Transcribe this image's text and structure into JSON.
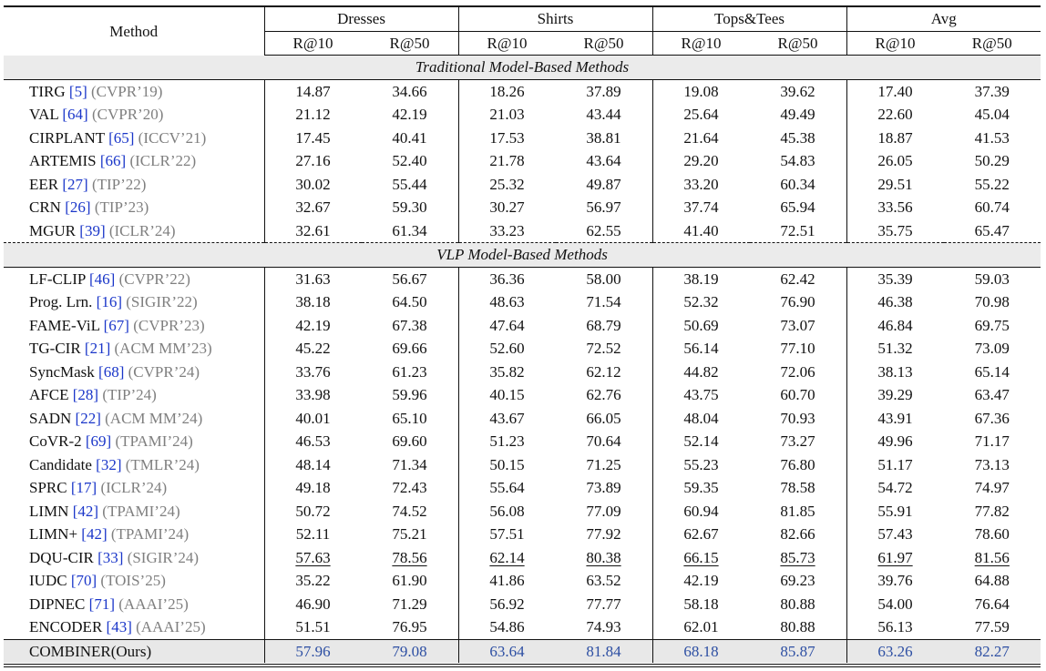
{
  "header": {
    "method": "Method",
    "groups": [
      "Dresses",
      "Shirts",
      "Tops&Tees",
      "Avg"
    ],
    "metrics": [
      "R@10",
      "R@50"
    ]
  },
  "sections": [
    {
      "title": "Traditional Model-Based Methods",
      "rows": [
        {
          "name": "TIRG",
          "cite": "5",
          "venue": "(CVPR’19)",
          "values": [
            "14.87",
            "34.66",
            "18.26",
            "37.89",
            "19.08",
            "39.62",
            "17.40",
            "37.39"
          ]
        },
        {
          "name": "VAL",
          "cite": "64",
          "venue": "(CVPR’20)",
          "values": [
            "21.12",
            "42.19",
            "21.03",
            "43.44",
            "25.64",
            "49.49",
            "22.60",
            "45.04"
          ]
        },
        {
          "name": "CIRPLANT",
          "cite": "65",
          "venue": "(ICCV’21)",
          "values": [
            "17.45",
            "40.41",
            "17.53",
            "38.81",
            "21.64",
            "45.38",
            "18.87",
            "41.53"
          ]
        },
        {
          "name": "ARTEMIS",
          "cite": "66",
          "venue": "(ICLR’22)",
          "values": [
            "27.16",
            "52.40",
            "21.78",
            "43.64",
            "29.20",
            "54.83",
            "26.05",
            "50.29"
          ]
        },
        {
          "name": "EER",
          "cite": "27",
          "venue": "(TIP’22)",
          "values": [
            "30.02",
            "55.44",
            "25.32",
            "49.87",
            "33.20",
            "60.34",
            "29.51",
            "55.22"
          ]
        },
        {
          "name": "CRN",
          "cite": "26",
          "venue": "(TIP’23)",
          "values": [
            "32.67",
            "59.30",
            "30.27",
            "56.97",
            "37.74",
            "65.94",
            "33.56",
            "60.74"
          ]
        },
        {
          "name": "MGUR",
          "cite": "39",
          "venue": "(ICLR’24)",
          "values": [
            "32.61",
            "61.34",
            "33.23",
            "62.55",
            "41.40",
            "72.51",
            "35.75",
            "65.47"
          ]
        }
      ]
    },
    {
      "title": "VLP Model-Based Methods",
      "rows": [
        {
          "name": "LF-CLIP",
          "cite": "46",
          "venue": "(CVPR’22)",
          "values": [
            "31.63",
            "56.67",
            "36.36",
            "58.00",
            "38.19",
            "62.42",
            "35.39",
            "59.03"
          ]
        },
        {
          "name": "Prog. Lrn.",
          "cite": "16",
          "venue": "(SIGIR’22)",
          "values": [
            "38.18",
            "64.50",
            "48.63",
            "71.54",
            "52.32",
            "76.90",
            "46.38",
            "70.98"
          ]
        },
        {
          "name": "FAME-ViL",
          "cite": "67",
          "venue": "(CVPR’23)",
          "values": [
            "42.19",
            "67.38",
            "47.64",
            "68.79",
            "50.69",
            "73.07",
            "46.84",
            "69.75"
          ]
        },
        {
          "name": "TG-CIR",
          "cite": "21",
          "venue": "(ACM MM’23)",
          "values": [
            "45.22",
            "69.66",
            "52.60",
            "72.52",
            "56.14",
            "77.10",
            "51.32",
            "73.09"
          ]
        },
        {
          "name": "SyncMask",
          "cite": "68",
          "venue": "(CVPR’24)",
          "values": [
            "33.76",
            "61.23",
            "35.82",
            "62.12",
            "44.82",
            "72.06",
            "38.13",
            "65.14"
          ]
        },
        {
          "name": "AFCE",
          "cite": "28",
          "venue": "(TIP’24)",
          "values": [
            "33.98",
            "59.96",
            "40.15",
            "62.76",
            "43.75",
            "60.70",
            "39.29",
            "63.47"
          ]
        },
        {
          "name": "SADN",
          "cite": "22",
          "venue": "(ACM MM’24)",
          "values": [
            "40.01",
            "65.10",
            "43.67",
            "66.05",
            "48.04",
            "70.93",
            "43.91",
            "67.36"
          ]
        },
        {
          "name": "CoVR-2",
          "cite": "69",
          "venue": "(TPAMI’24)",
          "values": [
            "46.53",
            "69.60",
            "51.23",
            "70.64",
            "52.14",
            "73.27",
            "49.96",
            "71.17"
          ]
        },
        {
          "name": "Candidate",
          "cite": "32",
          "venue": "(TMLR’24)",
          "values": [
            "48.14",
            "71.34",
            "50.15",
            "71.25",
            "55.23",
            "76.80",
            "51.17",
            "73.13"
          ]
        },
        {
          "name": "SPRC",
          "cite": "17",
          "venue": "(ICLR’24)",
          "values": [
            "49.18",
            "72.43",
            "55.64",
            "73.89",
            "59.35",
            "78.58",
            "54.72",
            "74.97"
          ]
        },
        {
          "name": "LIMN",
          "cite": "42",
          "venue": "(TPAMI’24)",
          "values": [
            "50.72",
            "74.52",
            "56.08",
            "77.09",
            "60.94",
            "81.85",
            "55.91",
            "77.82"
          ]
        },
        {
          "name": "LIMN+",
          "cite": "42",
          "venue": "(TPAMI’24)",
          "values": [
            "52.11",
            "75.21",
            "57.51",
            "77.92",
            "62.67",
            "82.66",
            "57.43",
            "78.60"
          ]
        },
        {
          "name": "DQU-CIR",
          "cite": "33",
          "venue": "(SIGIR’24)",
          "underline": true,
          "values": [
            "57.63",
            "78.56",
            "62.14",
            "80.38",
            "66.15",
            "85.73",
            "61.97",
            "81.56"
          ]
        },
        {
          "name": "IUDC",
          "cite": "70",
          "venue": "(TOIS’25)",
          "values": [
            "35.22",
            "61.90",
            "41.86",
            "63.52",
            "42.19",
            "69.23",
            "39.76",
            "64.88"
          ]
        },
        {
          "name": "DIPNEC",
          "cite": "71",
          "venue": "(AAAI’25)",
          "values": [
            "46.90",
            "71.29",
            "56.92",
            "77.77",
            "58.18",
            "80.88",
            "54.00",
            "76.64"
          ]
        },
        {
          "name": "ENCODER",
          "cite": "43",
          "venue": "(AAAI’25)",
          "values": [
            "51.51",
            "76.95",
            "54.86",
            "74.93",
            "62.01",
            "80.88",
            "56.13",
            "77.59"
          ]
        }
      ]
    }
  ],
  "ours": {
    "name": "COMBINER(Ours)",
    "values": [
      "57.96",
      "79.08",
      "63.64",
      "81.84",
      "68.18",
      "85.87",
      "63.26",
      "82.27"
    ]
  },
  "colors": {
    "cite": "#1a36c9",
    "venue": "#7f7f7f",
    "ours_values": "#2d4fa3",
    "band": "#ebebeb"
  }
}
